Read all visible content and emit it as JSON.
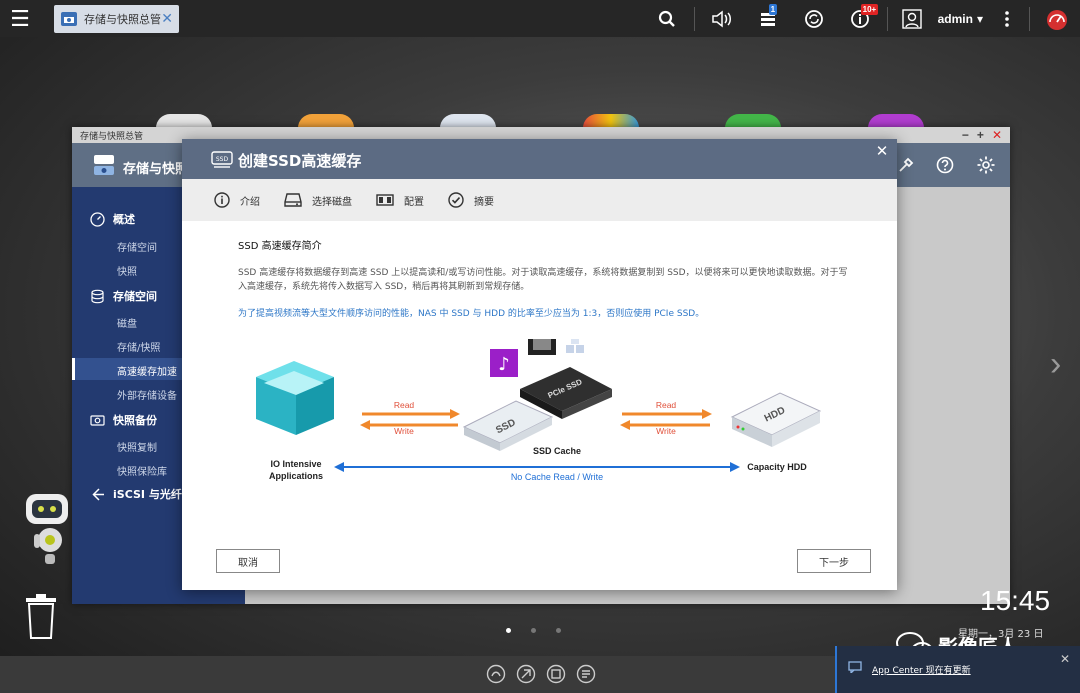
{
  "taskbar": {
    "tab_label": "存储与快照总管",
    "user": "admin",
    "notification_badge": "1",
    "alert_badge": "10+"
  },
  "outer_window": {
    "title": "存储与快照总管",
    "header_title": "存储与快照"
  },
  "sidebar": {
    "sections": [
      {
        "label": "概述",
        "icon": "dashboard-icon"
      },
      {
        "label": "存储空间",
        "icon": "database-icon"
      },
      {
        "label": "快照备份",
        "icon": "snapshot-icon"
      },
      {
        "label": "iSCSI 与光纤通",
        "icon": "link-icon"
      }
    ],
    "items": [
      "存储空间",
      "快照",
      "磁盘",
      "存储/快照",
      "高速缓存加速",
      "外部存储设备",
      "快照复制",
      "快照保险库"
    ],
    "active": "高速缓存加速"
  },
  "dialog": {
    "title": "创建SSD高速缓存",
    "steps": [
      "介绍",
      "选择磁盘",
      "配置",
      "摘要"
    ],
    "section_title": "SSD 高速缓存简介",
    "description": "SSD 高速缓存将数据缓存到高速 SSD 上以提高读和/或写访问性能。对于读取高速缓存，系统将数据复制到 SSD，以便将来可以更快地读取数据。对于写入高速缓存，系统先将传入数据写入 SSD，稍后再将其刷新到常规存储。",
    "note": "为了提高视频流等大型文件顺序访问的性能，NAS 中 SSD 与 HDD 的比率至少应当为 1:3，否则应使用 PCIe SSD。",
    "diagram": {
      "io_label_1": "IO Intensive",
      "io_label_2": "Applications",
      "read": "Read",
      "write": "Write",
      "ssd_cache": "SSD Cache",
      "capacity_hdd": "Capacity HDD",
      "no_cache": "No Cache Read / Write",
      "ssd_text": "SSD",
      "pcie_text": "PCIe SSD",
      "hdd_text": "HDD"
    },
    "cancel_label": "取消",
    "next_label": "下一步"
  },
  "desktop": {
    "clock": "15:45",
    "date": "星期一，3月 23 日",
    "watermark": "影像匠人"
  },
  "notification": {
    "text": "App Center 现在有更新"
  },
  "colors": {
    "dialog_header": "#5c6b83",
    "sidebar": "#233a70",
    "note_text": "#2e77c7",
    "arrow_blue": "#1f6fd6",
    "arrow_orange": "#f0882c"
  }
}
